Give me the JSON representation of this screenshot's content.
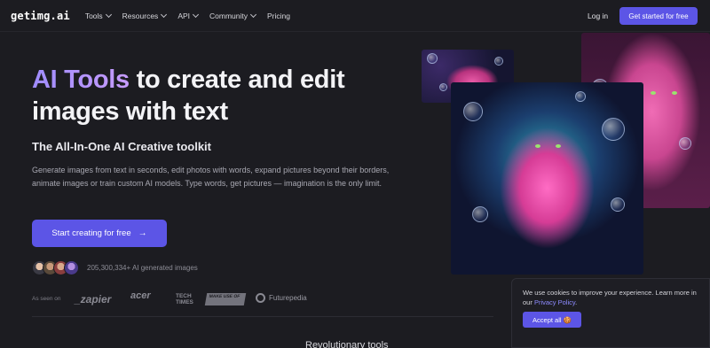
{
  "nav": {
    "logo": "getimg.ai",
    "links": [
      {
        "label": "Tools",
        "dropdown": true
      },
      {
        "label": "Resources",
        "dropdown": true
      },
      {
        "label": "API",
        "dropdown": true
      },
      {
        "label": "Community",
        "dropdown": true
      },
      {
        "label": "Pricing",
        "dropdown": false
      }
    ],
    "login": "Log in",
    "cta": "Get started for free"
  },
  "hero": {
    "title_highlight": "AI Tools",
    "title_rest": " to create and edit images with text",
    "subtitle": "The All-In-One AI Creative toolkit",
    "description": "Generate images from text in seconds, edit photos with words, expand pictures beyond their borders, animate images or train custom AI models. Type words, get pictures — imagination is the only limit.",
    "button": "Start creating for free",
    "button_icon": "→",
    "generated_count": "205,300,334+ AI generated images",
    "seen_on": "As seen on",
    "brands": {
      "zapier": "_zapier",
      "acer": "acer",
      "tech_times": "TECH\nTIMES",
      "make_use_of": "MAKE USE OF",
      "futurepedia": "Futurepedia"
    }
  },
  "bottom_peek": "Revolutionary tools",
  "cookie": {
    "text_before": "We use cookies to improve your experience. Learn more in our ",
    "link": "Privacy Policy",
    "text_after": ".",
    "button": "Accept all 🍪"
  },
  "colors": {
    "accent": "#5c55e6",
    "background": "#1c1c21",
    "gradient_start": "#9f8cff",
    "gradient_end": "#c79cff"
  }
}
